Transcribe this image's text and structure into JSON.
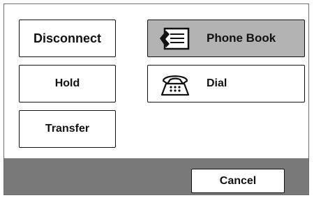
{
  "buttons": {
    "disconnect": "Disconnect",
    "hold": "Hold",
    "transfer": "Transfer",
    "phone_book": "Phone Book",
    "dial": "Dial",
    "cancel": "Cancel"
  },
  "selected": "phone_book",
  "icons": {
    "phone_book": "phone-book-icon",
    "dial": "telephone-icon"
  },
  "colors": {
    "selected_bg": "#b3b3b3",
    "footer_bg": "#797979",
    "border": "#111111"
  }
}
